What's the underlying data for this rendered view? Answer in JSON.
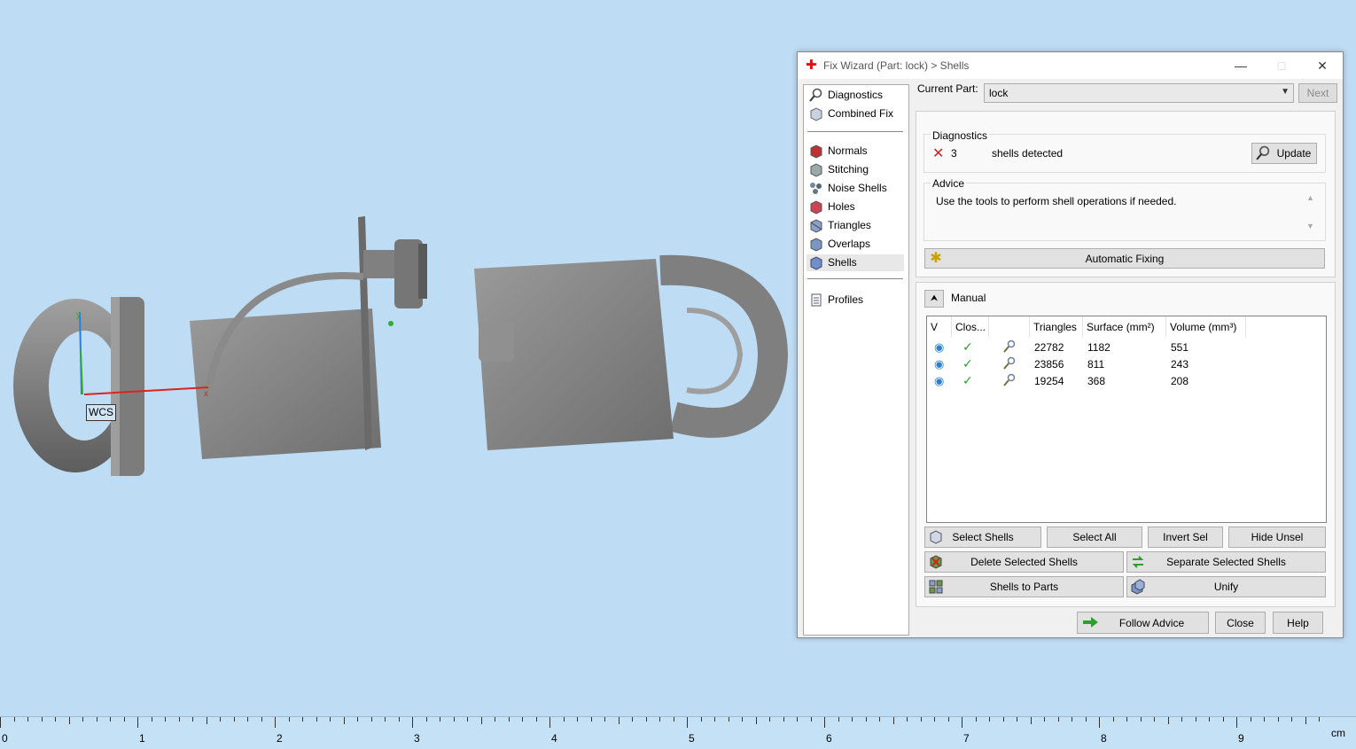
{
  "viewport": {
    "wcs_label": "WCS",
    "axis_x": "x",
    "axis_y": "y"
  },
  "ruler": {
    "labels": [
      "0",
      "1",
      "2",
      "3",
      "4",
      "5",
      "6",
      "7",
      "8",
      "9"
    ],
    "unit": "cm"
  },
  "window": {
    "title": "Fix Wizard (Part: lock) > Shells",
    "minimize": "—",
    "maximize": "□",
    "close": "✕"
  },
  "nav": {
    "top": [
      {
        "label": "Diagnostics",
        "icon": "magnifier-icon"
      },
      {
        "label": "Combined Fix",
        "icon": "cube-icon"
      }
    ],
    "tools": [
      {
        "label": "Normals",
        "icon": "normals-cube-icon"
      },
      {
        "label": "Stitching",
        "icon": "stitching-cube-icon"
      },
      {
        "label": "Noise Shells",
        "icon": "noise-shells-icon"
      },
      {
        "label": "Holes",
        "icon": "holes-cube-icon"
      },
      {
        "label": "Triangles",
        "icon": "triangles-cube-icon"
      },
      {
        "label": "Overlaps",
        "icon": "overlaps-cube-icon"
      },
      {
        "label": "Shells",
        "icon": "shells-cube-icon"
      }
    ],
    "bottom": [
      {
        "label": "Profiles",
        "icon": "profiles-document-icon"
      }
    ],
    "active": "Shells"
  },
  "current_part": {
    "label": "Current Part:",
    "value": "lock",
    "next_label": "Next"
  },
  "diagnostics": {
    "group_label": "Diagnostics",
    "count": "3",
    "text": "shells detected",
    "status_icon": "error-x-icon",
    "update_label": "Update"
  },
  "advice": {
    "group_label": "Advice",
    "text": "Use the tools to perform shell operations if needed."
  },
  "automatic_fixing_label": "Automatic Fixing",
  "manual": {
    "label": "Manual",
    "headers": [
      "V",
      "Clos...",
      "",
      "Triangles",
      "Surface (mm²)",
      "Volume (mm³)"
    ],
    "rows": [
      {
        "triangles": "22782",
        "surface": "1182",
        "volume": "551"
      },
      {
        "triangles": "23856",
        "surface": "811",
        "volume": "243"
      },
      {
        "triangles": "19254",
        "surface": "368",
        "volume": "208"
      }
    ],
    "buttons": {
      "select_shells": "Select Shells",
      "select_all": "Select All",
      "invert_sel": "Invert Sel",
      "hide_unsel": "Hide Unsel",
      "delete_selected": "Delete Selected Shells",
      "separate_selected": "Separate Selected Shells",
      "shells_to_parts": "Shells to Parts",
      "unify": "Unify"
    }
  },
  "footer": {
    "follow_advice": "Follow Advice",
    "close": "Close",
    "help": "Help"
  },
  "colors": {
    "viewport_bg": "#bedcf3",
    "model_gray": "#8c8c8c",
    "check_green": "#2e9e2e",
    "error_red": "#cc2222"
  }
}
